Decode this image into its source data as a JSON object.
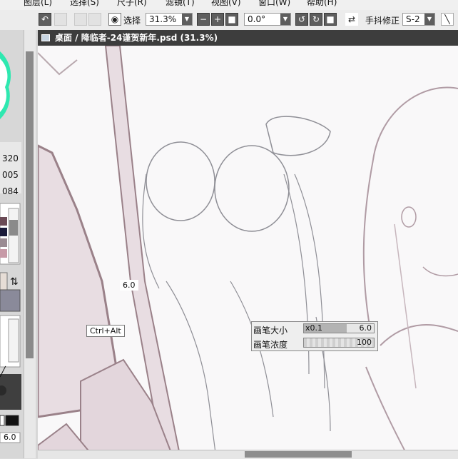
{
  "menu": [
    "图层(L)",
    "选择(S)",
    "尺子(R)",
    "滤镜(T)",
    "视图(V)",
    "窗口(W)",
    "帮助(H)"
  ],
  "toolbar": {
    "select_label": "选择",
    "zoom_value": "31.3%",
    "rotation_value": "0.0°",
    "stabilizer_label": "手抖修正",
    "stabilizer_value": "S-2"
  },
  "window": {
    "title": "桌面 / 降临者-24谨贺新年.psd (31.3%)"
  },
  "sidebar": {
    "values": [
      "320",
      "005",
      "084"
    ],
    "brush_size_value": "6.0"
  },
  "canvas": {
    "cursor_size_label": "6.0",
    "shortcut_tooltip": "Ctrl+Alt"
  },
  "brush_panel": {
    "size_label": "画笔大小",
    "size_multiplier": "x0.1",
    "size_value": "6.0",
    "density_label": "画笔浓度",
    "density_value": "100"
  },
  "colors": {
    "sketch_line": "#9a8189",
    "shadow_fill": "#e8dde2",
    "titlebar": "#3d3d3d"
  }
}
